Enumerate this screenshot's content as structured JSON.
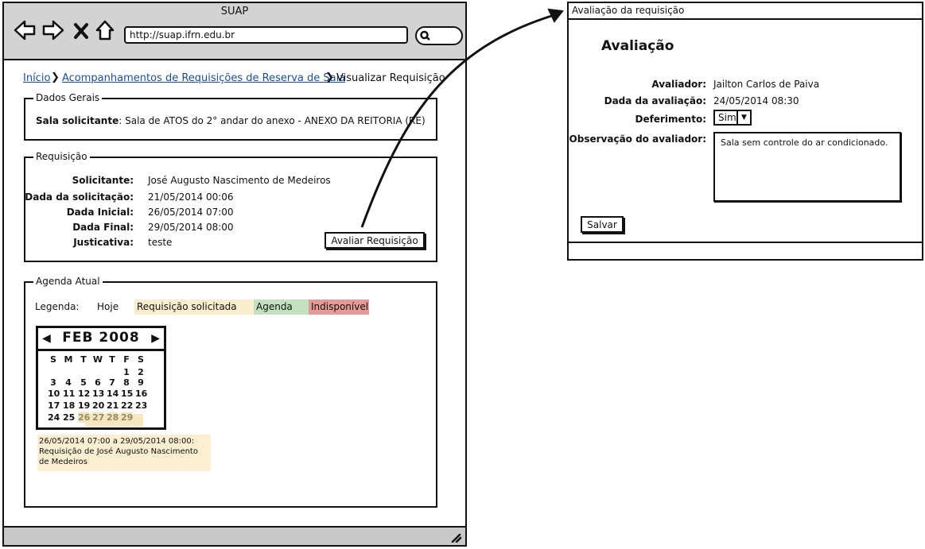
{
  "browser": {
    "title": "SUAP",
    "url": "http://suap.ifrn.edu.br"
  },
  "breadcrumb": {
    "items": [
      "Início",
      "Acompanhamentos de Requisições de Reserva de Sala",
      "Visualizar Requisição"
    ]
  },
  "dados_gerais": {
    "legend": "Dados Gerais",
    "sala_label": "Sala solicitante",
    "sala_value": ": Sala de ATOS do 2° andar do anexo - ANEXO DA REITORIA (RE)"
  },
  "requisicao": {
    "legend": "Requisição",
    "fields": [
      {
        "label": "Solicitante:",
        "value": "José Augusto Nascimento de Medeiros"
      },
      {
        "label": "Dada da solicitação:",
        "value": "21/05/2014 00:06"
      },
      {
        "label": "Dada Inicial:",
        "value": "26/05/2014 07:00"
      },
      {
        "label": "Dada Final:",
        "value": "29/05/2014 08:00"
      },
      {
        "label": "Justicativa:",
        "value": "teste"
      }
    ],
    "avaliar_button": "Avaliar Requisição"
  },
  "agenda": {
    "legend": "Agenda Atual",
    "legenda_label": "Legenda:",
    "keys": [
      {
        "label": "Hoje",
        "color": "#ffffff"
      },
      {
        "label": "Requisição solicitada",
        "color": "#fbeecf"
      },
      {
        "label": "Agenda",
        "color": "#c3e0bf"
      },
      {
        "label": "Indisponível",
        "color": "#e59a96"
      }
    ],
    "calendar": {
      "month": "FEB 2008",
      "prev_icon": "◀",
      "next_icon": "▶",
      "weekdays": [
        "S",
        "M",
        "T",
        "W",
        "T",
        "F",
        "S"
      ],
      "days": [
        "1",
        "2",
        "3",
        "4",
        "5",
        "6",
        "7",
        "8",
        "9",
        "10",
        "11",
        "12",
        "13",
        "14",
        "15",
        "16",
        "17",
        "18",
        "19",
        "20",
        "21",
        "22",
        "23",
        "24",
        "25",
        "26",
        "27",
        "28",
        "29"
      ]
    },
    "event_text": "26/05/2014 07:00 a 29/05/2014 08:00: Requisição de José Augusto Nascimento de Medeiros"
  },
  "dialog": {
    "title": "Avaliação da requisição",
    "heading": "Avaliação",
    "avaliador_label": "Avaliador:",
    "avaliador_value": "Jailton Carlos de Paiva",
    "data_label": "Dada da avaliação:",
    "data_value": "24/05/2014 08:30",
    "deferimento_label": "Deferimento:",
    "deferimento_value": "Sim",
    "observacao_label": "Observação do avaliador:",
    "observacao_value": "Sala sem controle do ar condicionado.",
    "save_button": "Salvar"
  }
}
